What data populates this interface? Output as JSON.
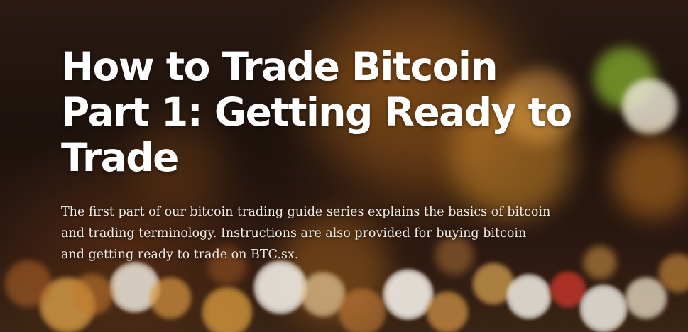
{
  "hero": {
    "title": "How to Trade Bitcoin Part 1: Getting Ready to Trade",
    "subtitle": "The first part of our bitcoin trading guide series explains the basics of bitcoin and trading terminology. Instructions are also provided for buying bitcoin and getting ready to trade on BTC.sx."
  },
  "colors": {
    "title_text": "#ffffff",
    "subtitle_text": "#f2ece6",
    "background_dark": "#1d120d"
  }
}
